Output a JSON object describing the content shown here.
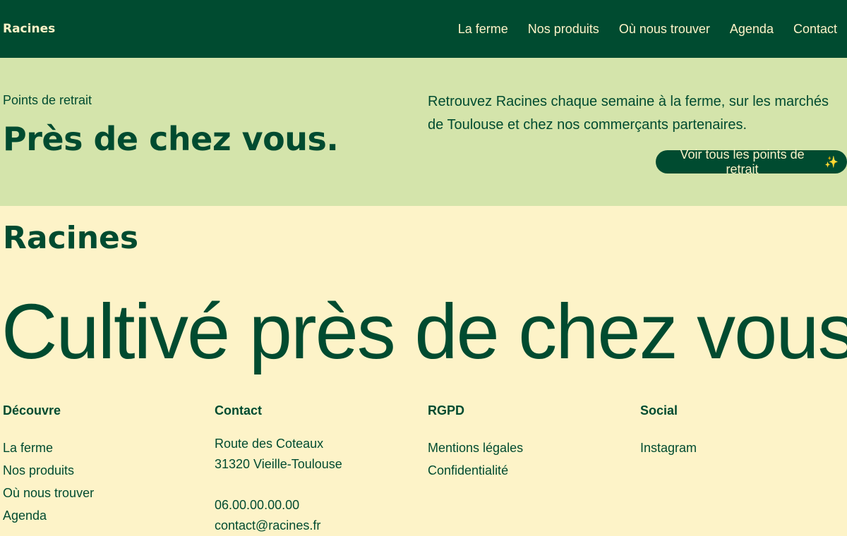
{
  "header": {
    "brand": "Racines",
    "nav": [
      "La ferme",
      "Nos produits",
      "Où nous trouver",
      "Agenda",
      "Contact"
    ]
  },
  "hero": {
    "eyebrow": "Points de retrait",
    "title": "Près de chez vous.",
    "text": "Retrouvez Racines chaque semaine à la ferme, sur les marchés de Toulouse et chez nos commerçants partenaires.",
    "cta_label": "Voir tous les points de retrait",
    "cta_icon": "sparkle-icon"
  },
  "footer": {
    "brand": "Racines",
    "tagline": "Cultivé près de chez vous.",
    "discover": {
      "heading": "Découvre",
      "links": [
        "La ferme",
        "Nos produits",
        "Où nous trouver",
        "Agenda"
      ]
    },
    "contact": {
      "heading": "Contact",
      "address": [
        "Route des Coteaux",
        "31320 Vieille-Toulouse"
      ],
      "phone": "06.00.00.00.00",
      "email": "contact@racines.fr"
    },
    "rgpd": {
      "heading": "RGPD",
      "links": [
        "Mentions légales",
        "Confidentialité"
      ]
    },
    "social": {
      "heading": "Social",
      "links": [
        "Instagram"
      ]
    }
  },
  "colors": {
    "dark_green": "#004b30",
    "light_green": "#d4e4ab",
    "cream": "#fdf3c8"
  }
}
